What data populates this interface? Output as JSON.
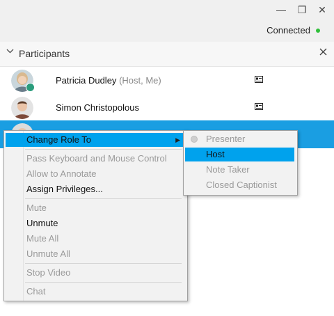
{
  "window": {
    "minimize_glyph": "—",
    "restore_glyph": "❐",
    "close_glyph": "✕"
  },
  "status": {
    "label": "Connected",
    "dot_color": "#2fbf3a"
  },
  "panel": {
    "title": "Participants"
  },
  "participants": [
    {
      "name": "Patricia Dudley",
      "role": "(Host, Me)"
    },
    {
      "name": "Simon Christopolous",
      "role": ""
    }
  ],
  "context_menu": {
    "items": [
      {
        "label": "Change Role To",
        "disabled": false,
        "highlighted": true,
        "has_submenu": true
      },
      {
        "label": "Pass Keyboard and Mouse Control",
        "disabled": true
      },
      {
        "label": "Allow to Annotate",
        "disabled": true
      },
      {
        "label": "Assign Privileges...",
        "disabled": false
      },
      {
        "label": "Mute",
        "disabled": true
      },
      {
        "label": "Unmute",
        "disabled": false
      },
      {
        "label": "Mute All",
        "disabled": true
      },
      {
        "label": "Unmute All",
        "disabled": true
      },
      {
        "label": "Stop Video",
        "disabled": true
      },
      {
        "label": "Chat",
        "disabled": true
      }
    ]
  },
  "role_submenu": {
    "items": [
      {
        "label": "Presenter",
        "disabled": true,
        "selected": true
      },
      {
        "label": "Host",
        "disabled": false,
        "highlighted": true
      },
      {
        "label": "Note Taker",
        "disabled": true
      },
      {
        "label": "Closed Captionist",
        "disabled": true
      }
    ]
  },
  "colors": {
    "selection": "#1a9ee2",
    "menu_highlight": "#00a2ed",
    "connected": "#2fbf3a"
  }
}
